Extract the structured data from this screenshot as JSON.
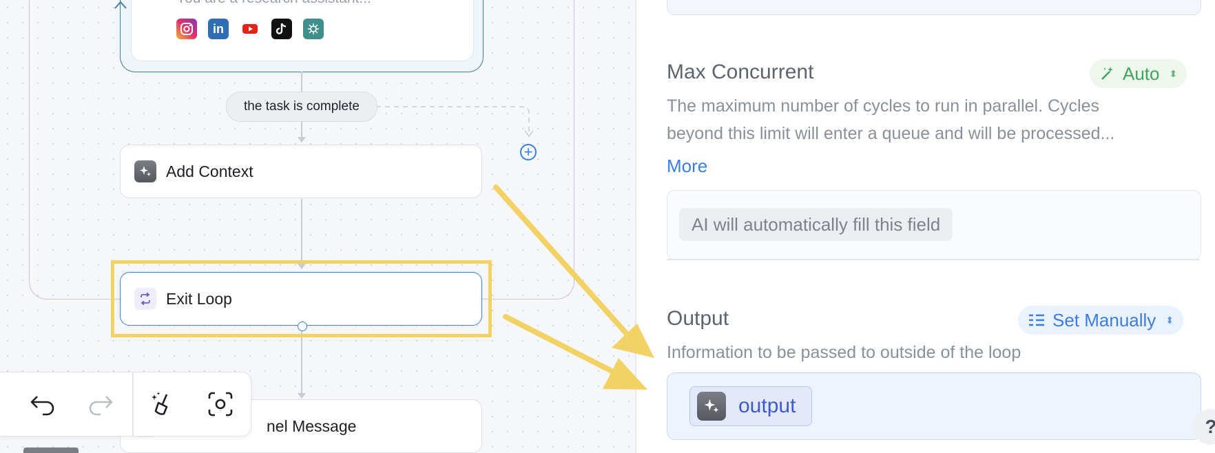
{
  "canvas": {
    "agent_node": {
      "description": "You are a research assistant...",
      "social_icons": [
        "instagram-icon",
        "linkedin-icon",
        "youtube-icon",
        "tiktok-icon",
        "scraper-icon"
      ]
    },
    "condition_label": "the task is complete",
    "nodes": [
      {
        "id": "add-context",
        "label": "Add Context",
        "icon": "sparkle-icon"
      },
      {
        "id": "exit-loop",
        "label": "Exit Loop",
        "icon": "loop-icon"
      },
      {
        "id": "channel-message",
        "label": "nel Message",
        "icon": "message-icon"
      }
    ],
    "toolbar": {
      "buttons": [
        "undo-icon",
        "redo-icon",
        "magic-clean-icon",
        "screenshot-icon"
      ]
    },
    "highlight_color": "#f3d265"
  },
  "panel": {
    "max_concurrent": {
      "title": "Max Concurrent",
      "mode": "Auto",
      "description_line1": "The maximum number of cycles to run in parallel. Cycles",
      "description_line2": "beyond this limit will enter a queue and will be processed...",
      "more_link": "More",
      "ai_placeholder": "AI will automatically fill this field"
    },
    "output": {
      "title": "Output",
      "mode": "Set Manually",
      "description": "Information to be passed to outside of the loop",
      "value_chip": "output"
    },
    "help_label": "?"
  },
  "colors": {
    "accent_blue": "#3b7de0",
    "auto_green": "#3fa55b",
    "arrow_yellow": "#f3d265"
  }
}
